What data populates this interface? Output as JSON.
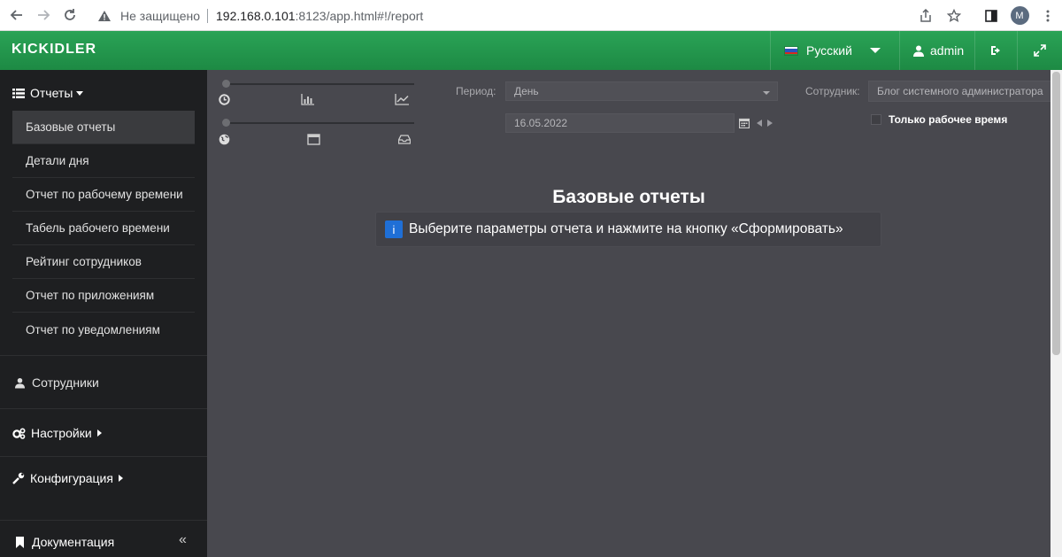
{
  "browser": {
    "security_label": "Не защищено",
    "url_host": "192.168.0.101",
    "url_path": ":8123/app.html#!/report",
    "profile_initial": "M"
  },
  "header": {
    "logo": "KICKIDLER",
    "language": "Русский",
    "user": "admin"
  },
  "sidebar": {
    "reports_title": "Отчеты",
    "reports_items": [
      "Базовые отчеты",
      "Детали дня",
      "Отчет по рабочему времени",
      "Табель рабочего времени",
      "Рейтинг сотрудников",
      "Отчет по приложениям",
      "Отчет по уведомлениям"
    ],
    "employees": "Сотрудники",
    "settings": "Настройки",
    "configuration": "Конфигурация",
    "documentation": "Документация",
    "collapse_glyph": "«"
  },
  "filters": {
    "period_label": "Период:",
    "period_value": "День",
    "date_value": "16.05.2022",
    "employee_label": "Сотрудник:",
    "employee_placeholder": "Блог системного администратора",
    "work_time_only": "Только рабочее время"
  },
  "main": {
    "title": "Базовые отчеты",
    "info_icon": "i",
    "info_text": "Выберите параметры отчета и нажмите на кнопку «Сформировать»"
  },
  "colors": {
    "header_green": "#1d8a44",
    "sidebar_bg": "#1e1f21",
    "content_bg": "#48484e",
    "info_blue": "#1f6fd6"
  },
  "icons": [
    "back-icon",
    "forward-icon",
    "reload-icon",
    "warning-icon",
    "share-icon",
    "star-icon",
    "sidepanel-icon",
    "clock-icon",
    "bar-chart-icon",
    "line-chart-icon",
    "globe-icon",
    "window-icon",
    "inbox-icon",
    "calendar-icon",
    "user-icon",
    "logout-icon",
    "fullscreen-icon",
    "cogs-icon",
    "wrench-icon",
    "list-icon"
  ]
}
